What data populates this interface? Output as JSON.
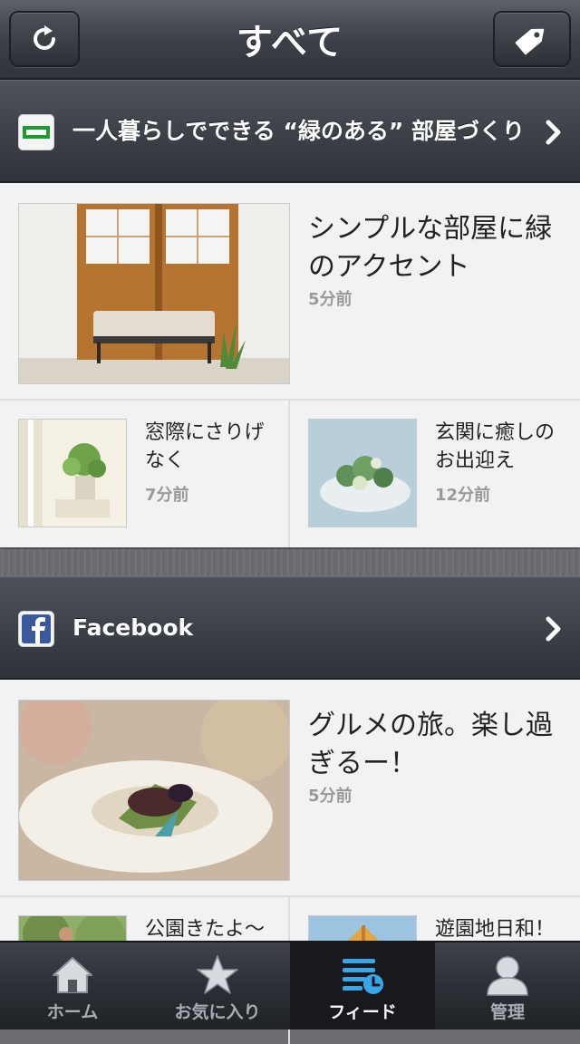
{
  "navbar": {
    "title": "すべて",
    "left_button_icon": "refresh-icon",
    "right_button_icon": "tag-icon"
  },
  "sections": [
    {
      "title": "一人暮らしでできる “緑のある” 部屋づくり",
      "icon": "green-feed-icon",
      "main": {
        "title": "シンプルな部屋に緑のアクセント",
        "time": "5分前"
      },
      "subs": [
        {
          "title": "窓際にさりげなく",
          "time": "7分前"
        },
        {
          "title": "玄関に癒しのお出迎え",
          "time": "12分前"
        }
      ]
    },
    {
      "title": "Facebook",
      "icon": "facebook-icon",
      "main": {
        "title": "グルメの旅。楽し過ぎるー！",
        "time": "5分前"
      },
      "subs": [
        {
          "title": "公園きたよ〜"
        },
        {
          "title": "遊園地日和！"
        }
      ]
    }
  ],
  "tabs": [
    {
      "label": "ホーム",
      "icon": "home-icon"
    },
    {
      "label": "お気に入り",
      "icon": "star-icon"
    },
    {
      "label": "フィード",
      "icon": "feed-icon",
      "active": true
    },
    {
      "label": "管理",
      "icon": "user-icon"
    }
  ],
  "colors": {
    "feed_accent": "#1e9a2e",
    "facebook_blue": "#3b5998",
    "active_tab_icon": "#3aa6e8"
  }
}
